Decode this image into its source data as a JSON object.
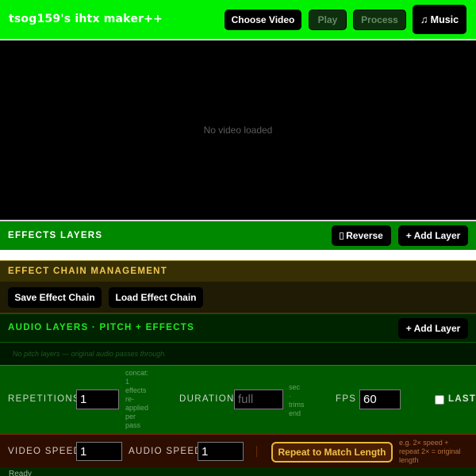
{
  "app": {
    "title": "tsog159's ihtx maker++"
  },
  "toolbar": {
    "choose_video": "Choose Video",
    "play": "Play",
    "process": "Process",
    "music": "Music"
  },
  "video": {
    "placeholder": "No video loaded"
  },
  "effects": {
    "title": "EFFECTS LAYERS",
    "reverse_label": "Reverse",
    "add_layer_label": "+ Add Layer"
  },
  "chain": {
    "title": "EFFECT CHAIN MANAGEMENT",
    "save_label": "Save Effect Chain",
    "load_label": "Load Effect Chain"
  },
  "audio": {
    "title": "AUDIO LAYERS · PITCH + EFFECTS",
    "add_layer_label": "+ Add Layer",
    "empty_text": "No pitch layers — original audio passes through."
  },
  "settings": {
    "repetitions_label": "REPETITIONS",
    "repetitions_value": "1",
    "repetitions_hint_lines": [
      "concat:",
      "1",
      "effects",
      "re-",
      "applied",
      "per",
      "pass"
    ],
    "duration_label": "DURATION",
    "duration_placeholder": "full",
    "duration_hint_lines": [
      "sec",
      "·",
      "trims",
      "end"
    ],
    "fps_label": "FPS",
    "fps_value": "60",
    "last_label": "LAST F"
  },
  "speed": {
    "video_speed_label": "VIDEO SPEED",
    "video_speed_value": "1",
    "audio_speed_label": "AUDIO SPEED",
    "audio_speed_value": "1",
    "repeat_label": "Repeat to Match Length",
    "hint_lines": [
      "e.g. 2× speed +",
      "repeat 2× = original",
      "length"
    ]
  },
  "status": {
    "text": "Ready"
  },
  "colors": {
    "topbar": "#00f100",
    "effects_header": "#008800",
    "chain_title": "#f0c850",
    "audio_title": "#22e622",
    "repeat_accent": "#e9b73a"
  },
  "icons": {
    "reverse": "reverse-icon",
    "music": "music-note-icon"
  }
}
